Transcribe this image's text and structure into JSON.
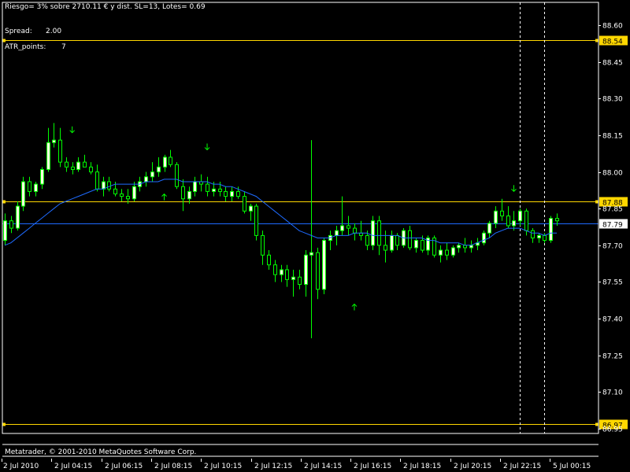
{
  "header": {
    "risk_text": "Riesgo= 3% sobre 2710.11 € y dist. SL=13, Lotes= 0.69",
    "spread_label": "Spread:",
    "spread_value": "2.00",
    "atr_label": "ATR_points:",
    "atr_value": "7"
  },
  "footer": {
    "copyright": "Metatrader, © 2001-2010 MetaQuotes Software Corp."
  },
  "colors": {
    "background": "#000000",
    "axis": "#ffffff",
    "bull_candle": "#ffffe0",
    "bear_candle": "#000000",
    "candle_border": "#00ff00",
    "ma_line": "#1e6bff",
    "hline": "#ffd700",
    "price_line": "#1e6bff",
    "arrow": "#00ff00",
    "label_bg": "#ffd700"
  },
  "chart_data": {
    "type": "candlestick",
    "ylim": [
      86.93,
      88.69
    ],
    "y_ticks": [
      "88.60",
      "88.45",
      "88.30",
      "88.15",
      "88.00",
      "87.85",
      "87.70",
      "87.55",
      "87.40",
      "87.25",
      "87.10",
      "86.95"
    ],
    "x_ticks": [
      "2 Jul 2010",
      "2 Jul 04:15",
      "2 Jul 06:15",
      "2 Jul 08:15",
      "2 Jul 10:15",
      "2 Jul 12:15",
      "2 Jul 14:15",
      "2 Jul 16:15",
      "2 Jul 18:15",
      "2 Jul 20:15",
      "2 Jul 22:15",
      "5 Jul 00:15"
    ],
    "horizontal_levels": [
      {
        "value": 88.54,
        "label": "88.54"
      },
      {
        "value": 87.88,
        "label": "87.88"
      },
      {
        "value": 86.97,
        "label": "86.97"
      }
    ],
    "current_price": {
      "value": 87.79,
      "label": "87.79"
    },
    "candles": [
      [
        87.72,
        87.83,
        87.7,
        87.8
      ],
      [
        87.8,
        87.82,
        87.75,
        87.77
      ],
      [
        87.77,
        87.88,
        87.76,
        87.86
      ],
      [
        87.86,
        87.98,
        87.84,
        87.96
      ],
      [
        87.96,
        87.98,
        87.9,
        87.92
      ],
      [
        87.92,
        87.96,
        87.9,
        87.95
      ],
      [
        87.95,
        88.02,
        87.93,
        88.01
      ],
      [
        88.01,
        88.18,
        88.0,
        88.12
      ],
      [
        88.12,
        88.2,
        88.1,
        88.13
      ],
      [
        88.13,
        88.18,
        88.02,
        88.04
      ],
      [
        88.04,
        88.06,
        88.0,
        88.02
      ],
      [
        88.02,
        88.04,
        87.99,
        88.01
      ],
      [
        88.01,
        88.06,
        88.0,
        88.04
      ],
      [
        88.04,
        88.07,
        88.02,
        88.02
      ],
      [
        88.02,
        88.04,
        87.99,
        88.0
      ],
      [
        88.0,
        88.03,
        87.92,
        87.93
      ],
      [
        87.93,
        87.98,
        87.9,
        87.96
      ],
      [
        87.96,
        87.98,
        87.92,
        87.93
      ],
      [
        87.93,
        87.96,
        87.9,
        87.91
      ],
      [
        87.91,
        87.93,
        87.88,
        87.9
      ],
      [
        87.9,
        87.93,
        87.87,
        87.89
      ],
      [
        87.89,
        87.96,
        87.88,
        87.94
      ],
      [
        87.94,
        87.98,
        87.92,
        87.96
      ],
      [
        87.96,
        88.0,
        87.94,
        87.98
      ],
      [
        87.98,
        88.04,
        87.96,
        88.0
      ],
      [
        88.0,
        88.06,
        87.98,
        88.02
      ],
      [
        88.02,
        88.07,
        88.0,
        88.06
      ],
      [
        88.06,
        88.09,
        88.02,
        88.03
      ],
      [
        88.03,
        88.04,
        87.93,
        87.94
      ],
      [
        87.94,
        87.97,
        87.84,
        87.89
      ],
      [
        87.89,
        87.94,
        87.87,
        87.92
      ],
      [
        87.92,
        87.98,
        87.9,
        87.96
      ],
      [
        87.96,
        87.99,
        87.92,
        87.95
      ],
      [
        87.95,
        87.98,
        87.9,
        87.92
      ],
      [
        87.92,
        87.96,
        87.9,
        87.93
      ],
      [
        87.93,
        87.96,
        87.9,
        87.92
      ],
      [
        87.92,
        87.94,
        87.88,
        87.9
      ],
      [
        87.9,
        87.94,
        87.88,
        87.92
      ],
      [
        87.92,
        87.94,
        87.89,
        87.9
      ],
      [
        87.9,
        87.92,
        87.83,
        87.84
      ],
      [
        87.84,
        87.87,
        87.8,
        87.86
      ],
      [
        87.86,
        87.87,
        87.72,
        87.74
      ],
      [
        87.74,
        87.76,
        87.62,
        87.66
      ],
      [
        87.66,
        87.68,
        87.6,
        87.62
      ],
      [
        87.62,
        87.64,
        87.55,
        87.58
      ],
      [
        87.58,
        87.62,
        87.55,
        87.6
      ],
      [
        87.6,
        87.62,
        87.53,
        87.56
      ],
      [
        87.56,
        87.6,
        87.49,
        87.57
      ],
      [
        87.57,
        87.6,
        87.52,
        87.54
      ],
      [
        87.54,
        87.68,
        87.49,
        87.66
      ],
      [
        87.66,
        88.13,
        87.32,
        87.67
      ],
      [
        87.67,
        87.69,
        87.48,
        87.52
      ],
      [
        87.52,
        87.73,
        87.5,
        87.72
      ],
      [
        87.72,
        87.76,
        87.68,
        87.74
      ],
      [
        87.74,
        87.78,
        87.7,
        87.76
      ],
      [
        87.76,
        87.9,
        87.74,
        87.78
      ],
      [
        87.78,
        87.82,
        87.74,
        87.77
      ],
      [
        87.77,
        87.79,
        87.72,
        87.75
      ],
      [
        87.75,
        87.8,
        87.72,
        87.74
      ],
      [
        87.74,
        87.76,
        87.68,
        87.7
      ],
      [
        87.7,
        87.82,
        87.68,
        87.8
      ],
      [
        87.8,
        87.82,
        87.66,
        87.7
      ],
      [
        87.7,
        87.76,
        87.63,
        87.68
      ],
      [
        87.68,
        87.76,
        87.67,
        87.74
      ],
      [
        87.74,
        87.75,
        87.68,
        87.7
      ],
      [
        87.7,
        87.77,
        87.69,
        87.76
      ],
      [
        87.76,
        87.78,
        87.68,
        87.69
      ],
      [
        87.69,
        87.73,
        87.67,
        87.72
      ],
      [
        87.72,
        87.74,
        87.67,
        87.68
      ],
      [
        87.68,
        87.74,
        87.66,
        87.73
      ],
      [
        87.73,
        87.74,
        87.65,
        87.66
      ],
      [
        87.66,
        87.7,
        87.63,
        87.68
      ],
      [
        87.68,
        87.71,
        87.64,
        87.66
      ],
      [
        87.66,
        87.7,
        87.65,
        87.69
      ],
      [
        87.69,
        87.71,
        87.67,
        87.7
      ],
      [
        87.7,
        87.73,
        87.67,
        87.69
      ],
      [
        87.69,
        87.72,
        87.67,
        87.7
      ],
      [
        87.7,
        87.73,
        87.68,
        87.71
      ],
      [
        87.71,
        87.76,
        87.7,
        87.75
      ],
      [
        87.75,
        87.8,
        87.73,
        87.79
      ],
      [
        87.79,
        87.86,
        87.77,
        87.84
      ],
      [
        87.84,
        87.89,
        87.8,
        87.82
      ],
      [
        87.82,
        87.86,
        87.77,
        87.78
      ],
      [
        87.78,
        87.84,
        87.76,
        87.8
      ],
      [
        87.8,
        87.85,
        87.78,
        87.84
      ],
      [
        87.84,
        87.85,
        87.74,
        87.76
      ],
      [
        87.76,
        87.77,
        87.71,
        87.73
      ],
      [
        87.73,
        87.75,
        87.71,
        87.74
      ],
      [
        87.74,
        87.75,
        87.71,
        87.72
      ],
      [
        87.72,
        87.82,
        87.71,
        87.81
      ],
      [
        87.81,
        87.83,
        87.78,
        87.8
      ]
    ],
    "ma": [
      87.7,
      87.71,
      87.73,
      87.75,
      87.77,
      87.79,
      87.81,
      87.83,
      87.85,
      87.87,
      87.88,
      87.89,
      87.9,
      87.91,
      87.92,
      87.93,
      87.93,
      87.94,
      87.95,
      87.95,
      87.95,
      87.95,
      87.95,
      87.96,
      87.96,
      87.96,
      87.97,
      87.97,
      87.97,
      87.96,
      87.96,
      87.96,
      87.96,
      87.96,
      87.95,
      87.95,
      87.94,
      87.94,
      87.93,
      87.92,
      87.91,
      87.9,
      87.88,
      87.86,
      87.84,
      87.82,
      87.8,
      87.78,
      87.76,
      87.75,
      87.74,
      87.73,
      87.73,
      87.73,
      87.74,
      87.74,
      87.74,
      87.75,
      87.75,
      87.75,
      87.74,
      87.74,
      87.74,
      87.74,
      87.74,
      87.73,
      87.73,
      87.73,
      87.73,
      87.72,
      87.72,
      87.71,
      87.71,
      87.71,
      87.71,
      87.7,
      87.7,
      87.71,
      87.72,
      87.73,
      87.75,
      87.76,
      87.77,
      87.77,
      87.77,
      87.76,
      87.75,
      87.75,
      87.74,
      87.75,
      87.75
    ],
    "arrows": [
      {
        "index": 11,
        "dir": "down",
        "price": 88.17
      },
      {
        "index": 26,
        "dir": "up",
        "price": 87.9
      },
      {
        "index": 33,
        "dir": "down",
        "price": 88.1
      },
      {
        "index": 57,
        "dir": "up",
        "price": 87.45
      },
      {
        "index": 83,
        "dir": "down",
        "price": 87.93
      }
    ],
    "vlines": [
      84,
      88
    ]
  }
}
